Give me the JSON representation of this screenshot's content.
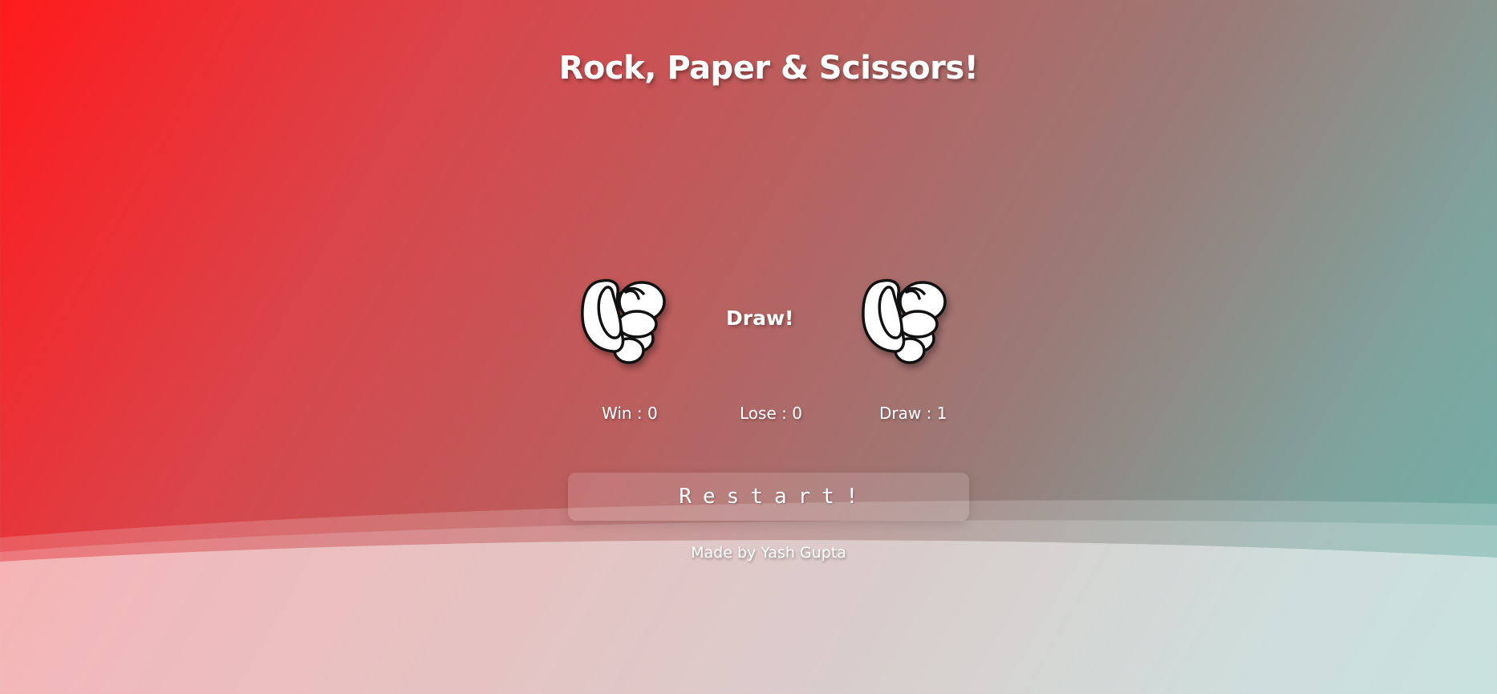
{
  "game": {
    "title": "Rock, Paper & Scissors!",
    "result": "Draw!",
    "player_choice": "rock-hand-icon",
    "computer_choice": "rock-hand-icon"
  },
  "scores": {
    "win_label": "Win : 0",
    "lose_label": "Lose : 0",
    "draw_label": "Draw : 1"
  },
  "controls": {
    "restart_label": "Restart!"
  },
  "footer": {
    "credit": "Made by Yash Gupta"
  },
  "colors": {
    "gradient_start": "#ff1a1c",
    "gradient_end": "#6db3aa",
    "text": "#ffffff"
  }
}
